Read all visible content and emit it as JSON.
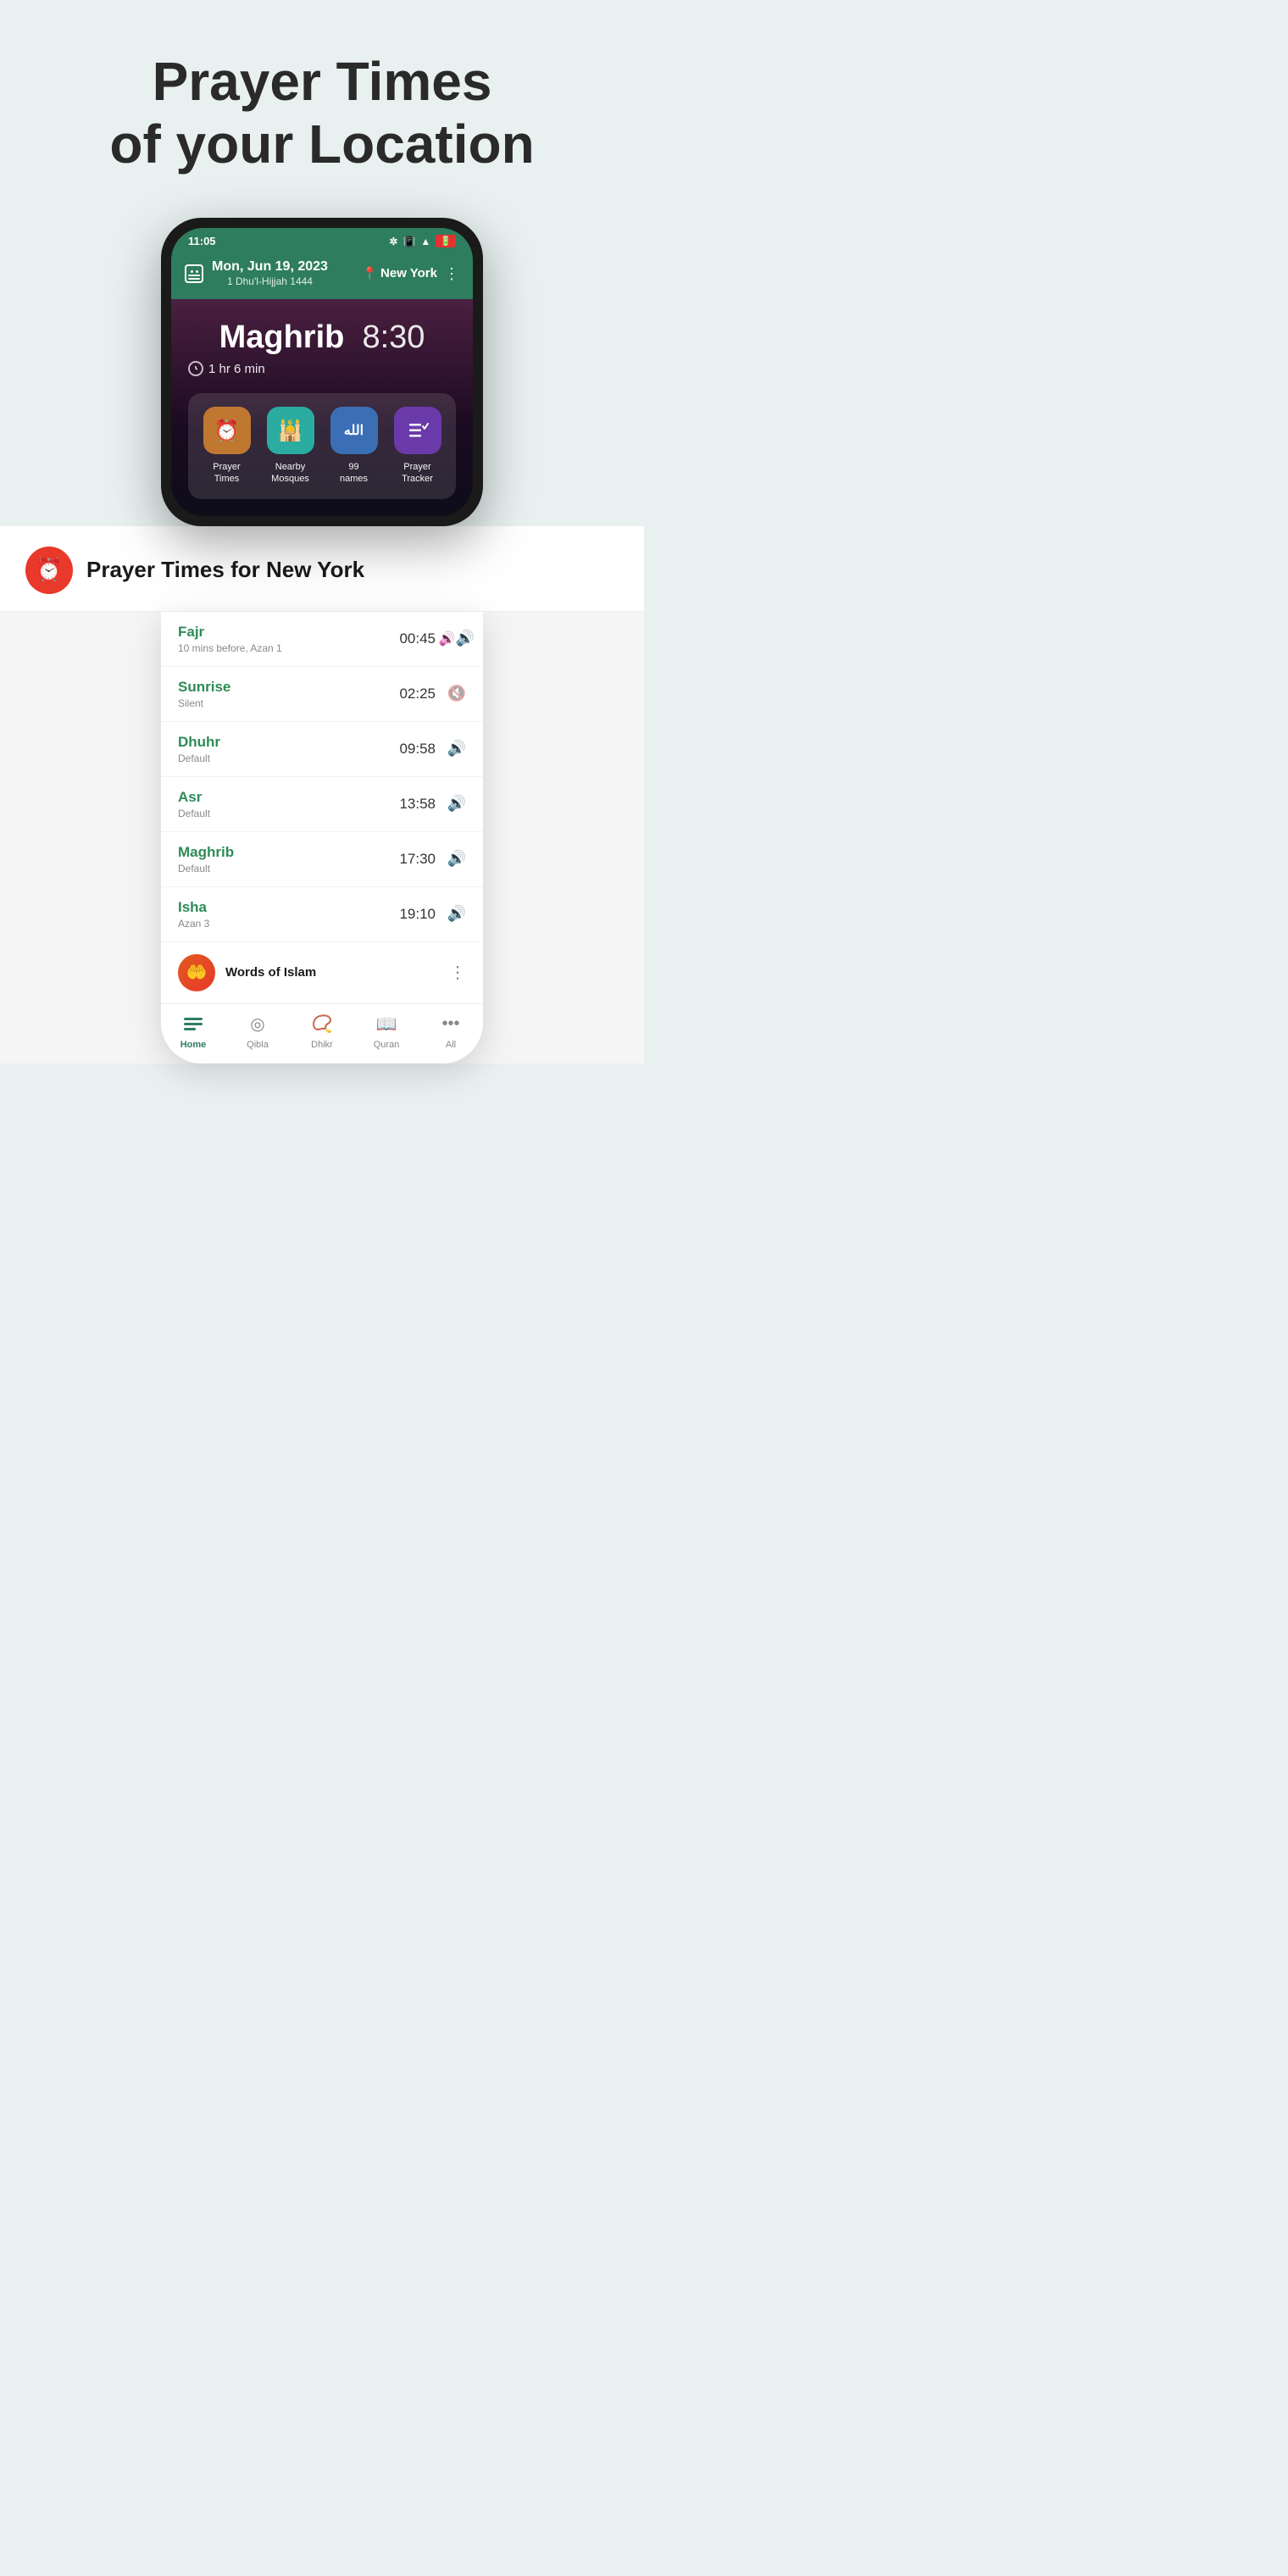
{
  "hero": {
    "title_line1": "Prayer Times",
    "title_line2": "of your Location",
    "bg_color": "#e8f0f0"
  },
  "phone1": {
    "status_bar": {
      "time": "11:05",
      "icons": [
        "bluetooth",
        "vibrate",
        "wifi",
        "battery"
      ]
    },
    "header": {
      "date": "Mon, Jun 19, 2023",
      "hijri": "1 Dhu'l-Hijjah 1444",
      "location": "New York"
    },
    "current_prayer": {
      "name": "Maghrib",
      "time": "8:30",
      "countdown": "1 hr 6 min"
    },
    "quick_actions": [
      {
        "label": "Prayer\nTimes",
        "icon": "⏰",
        "color": "brown"
      },
      {
        "label": "Nearby\nMosques",
        "icon": "🕌",
        "color": "teal"
      },
      {
        "label": "99\nnames",
        "icon": "الله",
        "color": "blue"
      },
      {
        "label": "Prayer\nTracker",
        "icon": "☰✓",
        "color": "purple"
      }
    ]
  },
  "section2": {
    "icon": "⏰",
    "title": "Prayer Times for New York",
    "prayers": [
      {
        "name": "Fajr",
        "sub": "10 mins before, Azan 1",
        "time": "00:45",
        "sound": "on"
      },
      {
        "name": "Sunrise",
        "sub": "Silent",
        "time": "02:25",
        "sound": "off"
      },
      {
        "name": "Dhuhr",
        "sub": "Default",
        "time": "09:58",
        "sound": "on"
      },
      {
        "name": "Asr",
        "sub": "Default",
        "time": "13:58",
        "sound": "on"
      },
      {
        "name": "Maghrib",
        "sub": "Default",
        "time": "17:30",
        "sound": "on"
      },
      {
        "name": "Isha",
        "sub": "Azan 3",
        "time": "19:10",
        "sound": "on"
      }
    ],
    "words_of_islam": "Words of Islam",
    "bottom_nav": [
      {
        "label": "Home",
        "active": true
      },
      {
        "label": "Qibla",
        "active": false
      },
      {
        "label": "Dhikr",
        "active": false
      },
      {
        "label": "Quran",
        "active": false
      },
      {
        "label": "All",
        "active": false
      }
    ]
  }
}
